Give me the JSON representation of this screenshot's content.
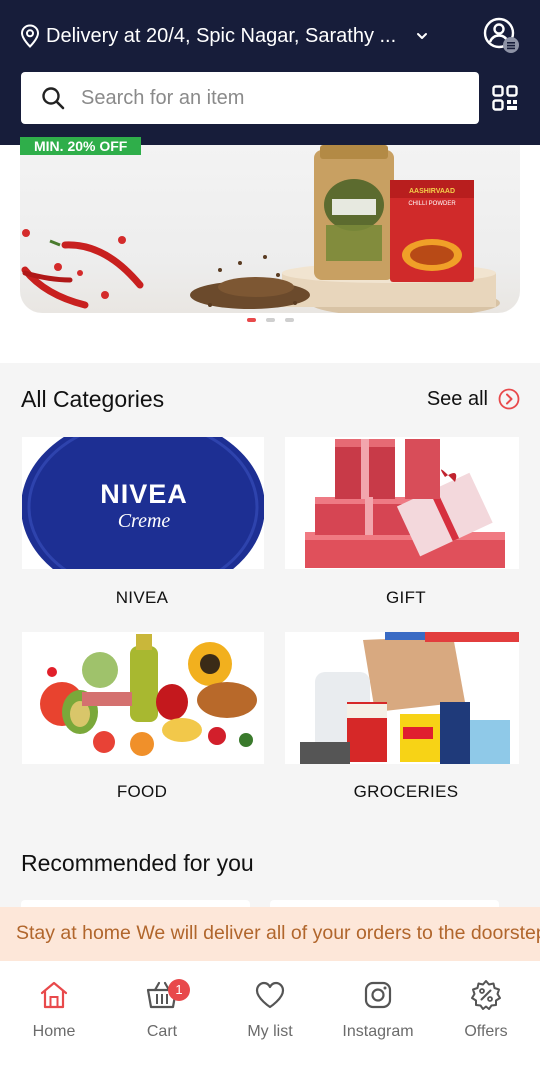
{
  "header": {
    "location_text": "Delivery at 20/4, Spic Nagar, Sarathy ...",
    "search_placeholder": "Search for an item"
  },
  "banner": {
    "offer_tag": "MIN. 20% OFF",
    "product_brand": "AASHIRVAAD",
    "product_name": "CHILLI POWDER",
    "dots_count": 3,
    "active_dot": 0
  },
  "categories": {
    "title": "All Categories",
    "see_all": "See all",
    "items": [
      {
        "label": "NIVEA",
        "logo_text": "NIVEA",
        "logo_sub": "Creme"
      },
      {
        "label": "GIFT"
      },
      {
        "label": "FOOD"
      },
      {
        "label": "GROCERIES"
      }
    ]
  },
  "recommended": {
    "title": "Recommended for you"
  },
  "marquee": {
    "text": "Stay at home We will deliver all of your orders to the doorstep"
  },
  "nav": {
    "items": [
      {
        "label": "Home",
        "icon": "home-icon"
      },
      {
        "label": "Cart",
        "icon": "cart-icon",
        "badge": "1"
      },
      {
        "label": "My list",
        "icon": "heart-icon"
      },
      {
        "label": "Instagram",
        "icon": "instagram-icon"
      },
      {
        "label": "Offers",
        "icon": "offers-icon"
      }
    ]
  },
  "colors": {
    "header_bg": "#171d3a",
    "accent": "#e8494b",
    "offer_green": "#2fae4a",
    "marquee_bg": "#fde7d9",
    "marquee_text": "#b1662c"
  }
}
